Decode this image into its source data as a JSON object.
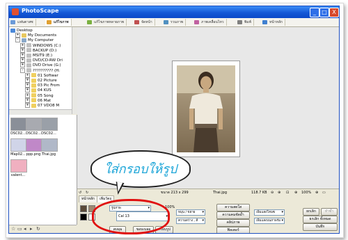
{
  "window": {
    "title": "PhotoScape",
    "controls": [
      "_",
      "□",
      "X"
    ]
  },
  "tabs": [
    {
      "label": "แฟนตาสซ",
      "color": "#6a9ad8"
    },
    {
      "label": "แก้ไขภาพ",
      "color": "#e0a030",
      "active": true
    },
    {
      "label": "แก้ไขภาพหลายภาพ",
      "color": "#7ab040"
    },
    {
      "label": "จัดหน้า",
      "color": "#c05050"
    },
    {
      "label": "รวมภาพ",
      "color": "#5090c0"
    },
    {
      "label": "ภาพเคลื่อนไหว",
      "color": "#c060a0"
    },
    {
      "label": "พิมพ์",
      "color": "#808080"
    },
    {
      "label": "หน้าหลัก",
      "color": "#4080d0"
    }
  ],
  "tree": [
    {
      "label": "Desktop",
      "indent": 0,
      "exp": "",
      "color": "#4a88d8"
    },
    {
      "label": "My Documents",
      "indent": 1,
      "exp": "+",
      "color": "#e8c860"
    },
    {
      "label": "My Computer",
      "indent": 1,
      "exp": "-",
      "color": "#8aa8c8"
    },
    {
      "label": "WINDOWS (C:)",
      "indent": 2,
      "exp": "+",
      "color": "#c0c0c0"
    },
    {
      "label": "BACKUP (D:)",
      "indent": 2,
      "exp": "+",
      "color": "#c0c0c0"
    },
    {
      "label": "MSIT9 (E:)",
      "indent": 2,
      "exp": "+",
      "color": "#c0c0c0"
    },
    {
      "label": "DVD/CD-RW Dri",
      "indent": 2,
      "exp": "+",
      "color": "#c0c0c0"
    },
    {
      "label": "DVD Drive (G:)",
      "indent": 2,
      "exp": "+",
      "color": "#c0c0c0"
    },
    {
      "label": "?????????? (H:",
      "indent": 2,
      "exp": "-",
      "color": "#c0c0c0"
    },
    {
      "label": "01 Softwar",
      "indent": 3,
      "exp": "+",
      "color": "#f0d060"
    },
    {
      "label": "02 Picture",
      "indent": 3,
      "exp": "+",
      "color": "#f0d060"
    },
    {
      "label": "03 Pic From",
      "indent": 3,
      "exp": "+",
      "color": "#f0d060"
    },
    {
      "label": "04 KUS",
      "indent": 3,
      "exp": "+",
      "color": "#f0d060"
    },
    {
      "label": "05 Song",
      "indent": 3,
      "exp": "+",
      "color": "#f0d060"
    },
    {
      "label": "06 Mat",
      "indent": 3,
      "exp": "+",
      "color": "#f0d060"
    },
    {
      "label": "07 VDO8 M",
      "indent": 3,
      "exp": "+",
      "color": "#f0d060"
    }
  ],
  "thumbnails": [
    {
      "label": "DSC02...",
      "color": "#8a8f98"
    },
    {
      "label": "DSC02...",
      "color": "#a8aab0"
    },
    {
      "label": "DSC02...",
      "color": "#9aa0a8"
    },
    {
      "label": "Map02...",
      "color": "#d0d4e8"
    },
    {
      "label": "ppp.png",
      "color": "#c088c8"
    },
    {
      "label": "Thai.jpg",
      "color": "#b0b8c8"
    },
    {
      "label": "valent...",
      "color": "#f0b0c0"
    }
  ],
  "status": {
    "size": "ขนาด 213 x 299",
    "file": "Thai.jpg",
    "filesize": "118.7 KB",
    "zoom": "100%"
  },
  "panel": {
    "tabs": [
      "หน้าหลัก",
      "เพิ่มวัตถุ"
    ],
    "percent": "100%",
    "frame_select": "Cal 13",
    "dropdown_top": "รูปภาพ",
    "buttons_mid": [
      "ความสดใส",
      "ความคมชัดย้ำ",
      "คลิปภาพ",
      "ฟิลเตอร์"
    ],
    "dropdowns_left": [
      "หมุน / ขยาย",
      "ความสว่าง , สี"
    ],
    "dropdowns_right": [
      "เพิ่มแสงโทนซ",
      "เพิ่มแสงบนภาพร่ม"
    ],
    "right_buttons": [
      "ยกเลิก",
      "ทำซ้ำ",
      "ยกเลิก ทั้งหมด",
      "บันทึก"
    ],
    "bottom_buttons": [
      "ลบมุม",
      "ขอบเบลอ",
      "กรอบรูป"
    ]
  },
  "callout": {
    "text": "ใส่กรอบให้รูป"
  }
}
